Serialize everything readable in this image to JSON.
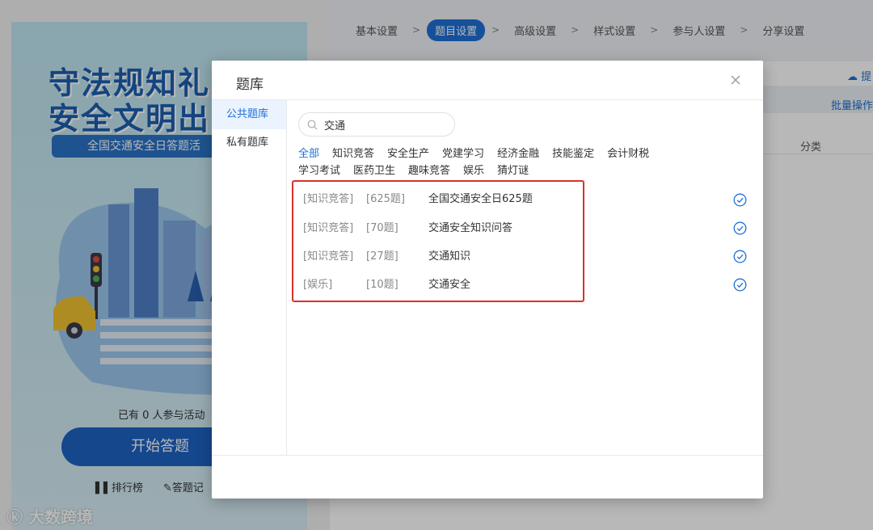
{
  "background": {
    "poster": {
      "title_line1": "守法规知礼",
      "title_line2": "安全文明出",
      "subtitle": "全国交通安全日答题活",
      "participants": "已有 0 人参与活动",
      "start_button": "开始答题",
      "ranking_link": "排行榜",
      "record_link": "答题记"
    },
    "steps": [
      "基本设置",
      "题目设置",
      "高级设置",
      "样式设置",
      "参与人设置",
      "分享设置"
    ],
    "step_separator": ">",
    "upload_link": "提",
    "batch_link": "批量操作",
    "category_header": "分类",
    "watermark": "大数跨境"
  },
  "modal": {
    "title": "题库",
    "sidebar": [
      {
        "label": "公共题库",
        "active": true
      },
      {
        "label": "私有题库",
        "active": false
      }
    ],
    "search": {
      "value": "交通",
      "placeholder": ""
    },
    "categories": [
      {
        "label": "全部",
        "active": true
      },
      {
        "label": "知识竞答",
        "active": false
      },
      {
        "label": "安全生产",
        "active": false
      },
      {
        "label": "党建学习",
        "active": false
      },
      {
        "label": "经济金融",
        "active": false
      },
      {
        "label": "技能鉴定",
        "active": false
      },
      {
        "label": "会计财税",
        "active": false
      },
      {
        "label": "学习考试",
        "active": false
      },
      {
        "label": "医药卫生",
        "active": false
      },
      {
        "label": "趣味竞答",
        "active": false
      },
      {
        "label": "娱乐",
        "active": false
      },
      {
        "label": "猜灯谜",
        "active": false
      }
    ],
    "results": [
      {
        "tag": "[知识竞答]",
        "count": "[625题]",
        "name": "全国交通安全日625题"
      },
      {
        "tag": "[知识竞答]",
        "count": "[70题]",
        "name": "交通安全知识问答"
      },
      {
        "tag": "[知识竞答]",
        "count": "[27题]",
        "name": "交通知识"
      },
      {
        "tag": "[娱乐]",
        "count": "[10题]",
        "name": "交通安全"
      }
    ]
  },
  "colors": {
    "accent": "#1f6fd6",
    "highlight_border": "#d9302c",
    "poster_blue": "#1d5fb0"
  }
}
